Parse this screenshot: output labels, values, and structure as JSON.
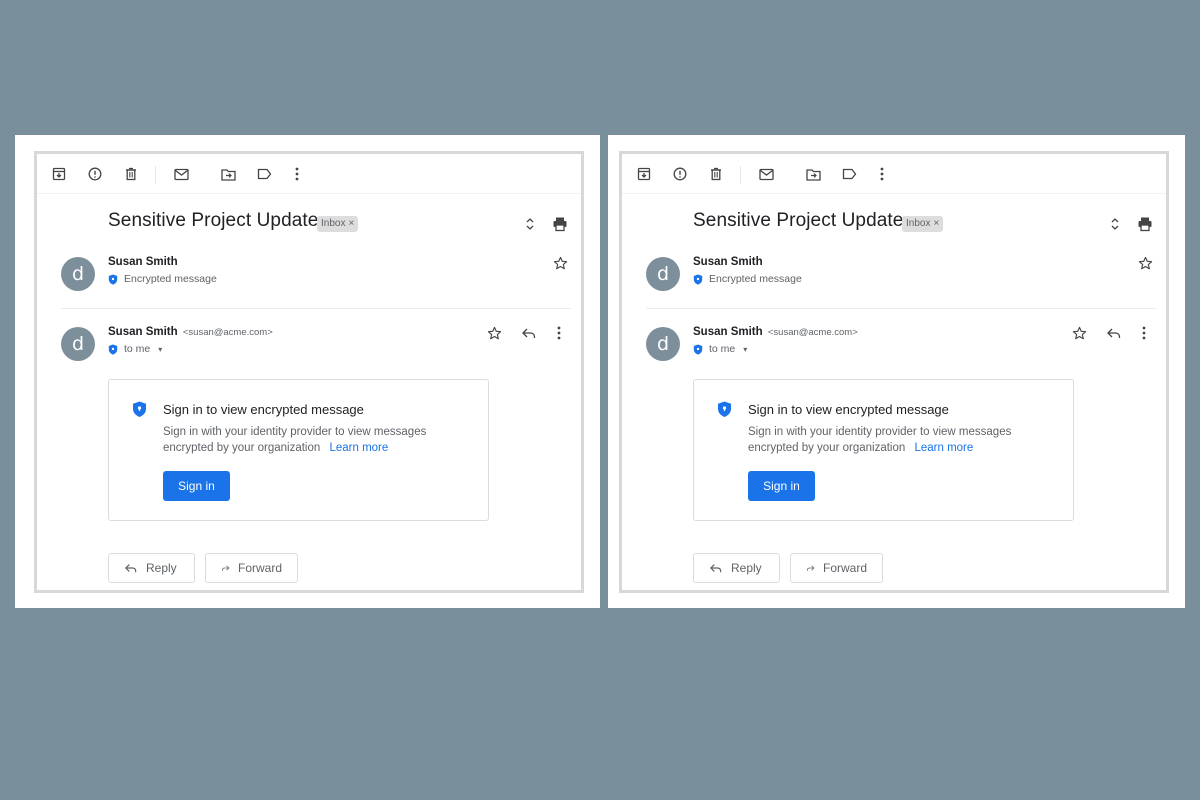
{
  "colors": {
    "background": "#7a8f9c",
    "accent": "#1a73e8",
    "avatar": "#7c8f9b"
  },
  "panels": [
    {
      "toolbar": {
        "icons": [
          "archive-icon",
          "report-spam-icon",
          "delete-icon",
          "mark-unread-icon",
          "move-to-icon",
          "label-icon",
          "more-vert-icon"
        ]
      },
      "subject": "Sensitive Project Update",
      "label_chip": {
        "text": "Inbox",
        "remove": "×"
      },
      "messages": [
        {
          "avatar_letter": "d",
          "sender": "Susan Smith",
          "snippet": "Encrypted message"
        },
        {
          "avatar_letter": "d",
          "sender": "Susan Smith",
          "email": "<susan@acme.com>",
          "recipient": "to me",
          "caret": "▾"
        }
      ],
      "encrypted_box": {
        "title": "Sign in to view encrypted message",
        "description": "Sign in with your identity provider to view messages encrypted by your organization",
        "learn_more": "Learn  more",
        "sign_in_button": "Sign in"
      },
      "actions": {
        "reply": "Reply",
        "forward": "Forward"
      }
    },
    {
      "toolbar": {
        "icons": [
          "archive-icon",
          "report-spam-icon",
          "delete-icon",
          "mark-unread-icon",
          "move-to-icon",
          "label-icon",
          "more-vert-icon"
        ]
      },
      "subject": "Sensitive Project Update",
      "label_chip": {
        "text": "Inbox",
        "remove": "×"
      },
      "messages": [
        {
          "avatar_letter": "d",
          "sender": "Susan Smith",
          "snippet": "Encrypted message"
        },
        {
          "avatar_letter": "d",
          "sender": "Susan Smith",
          "email": "<susan@acme.com>",
          "recipient": "to me",
          "caret": "▾"
        }
      ],
      "encrypted_box": {
        "title": "Sign in to view encrypted message",
        "description": "Sign in with your identity provider to view messages encrypted by your organization",
        "learn_more": "Learn  more",
        "sign_in_button": "Sign in"
      },
      "actions": {
        "reply": "Reply",
        "forward": "Forward"
      }
    }
  ]
}
